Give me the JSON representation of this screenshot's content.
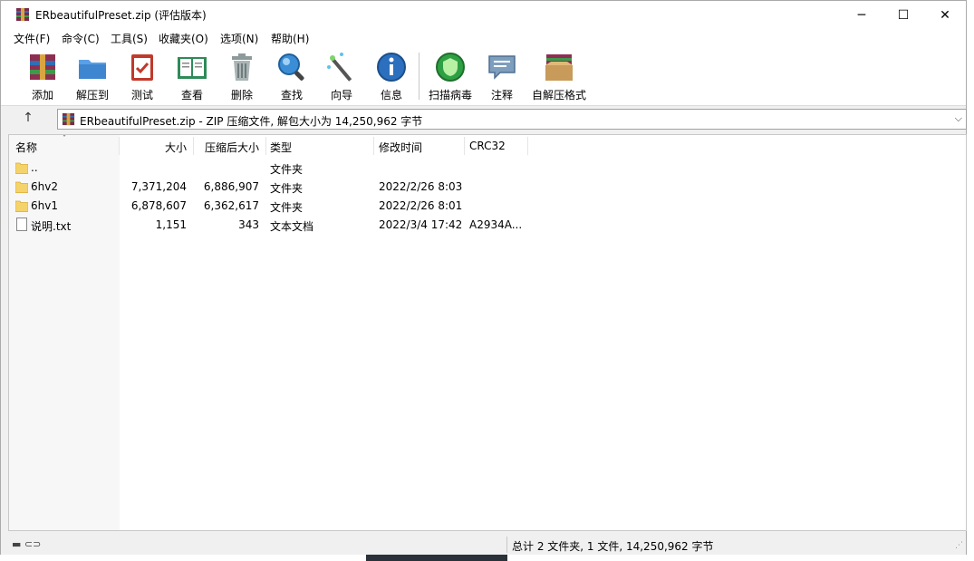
{
  "window": {
    "title": "ERbeautifulPreset.zip (评估版本)",
    "min_glyph": "─",
    "max_glyph": "☐",
    "close_glyph": "✕"
  },
  "menu": [
    {
      "label": "文件(F)"
    },
    {
      "label": "命令(C)"
    },
    {
      "label": "工具(S)"
    },
    {
      "label": "收藏夹(O)"
    },
    {
      "label": "选项(N)"
    },
    {
      "label": "帮助(H)"
    }
  ],
  "toolbar": [
    {
      "label": "添加",
      "icon": "add-archive-icon",
      "color": "#b03a5b"
    },
    {
      "label": "解压到",
      "icon": "extract-folder-icon",
      "color": "#4a90d9"
    },
    {
      "label": "测试",
      "icon": "test-clipboard-icon",
      "color": "#c0392b"
    },
    {
      "label": "查看",
      "icon": "view-book-icon",
      "color": "#2e8b57"
    },
    {
      "label": "删除",
      "icon": "trash-icon",
      "color": "#7f8c8d"
    },
    {
      "label": "查找",
      "icon": "magnifier-icon",
      "color": "#2980b9"
    },
    {
      "label": "向导",
      "icon": "wizard-wand-icon",
      "color": "#5a5a5a"
    },
    {
      "label": "信息",
      "icon": "info-icon",
      "color": "#2c6fbf"
    },
    {
      "label": "扫描病毒",
      "icon": "virus-scan-icon",
      "color": "#2ea043"
    },
    {
      "label": "注释",
      "icon": "comment-icon",
      "color": "#6d8fb0"
    },
    {
      "label": "自解压格式",
      "icon": "sfx-box-icon",
      "color": "#c89b5a"
    }
  ],
  "address": {
    "up_glyph": "↑",
    "text": "ERbeautifulPreset.zip - ZIP 压缩文件, 解包大小为 14,250,962 字节",
    "dropdown_glyph": "⌵"
  },
  "columns": {
    "name": "名称",
    "sort_glyph": "ˇ",
    "size": "大小",
    "packed": "压缩后大小",
    "type": "类型",
    "modified": "修改时间",
    "crc": "CRC32"
  },
  "rows": [
    {
      "name": "..",
      "size": "",
      "packed": "",
      "type": "文件夹",
      "modified": "",
      "crc": "",
      "kind": "folder"
    },
    {
      "name": "6hv2",
      "size": "7,371,204",
      "packed": "6,886,907",
      "type": "文件夹",
      "modified": "2022/2/26 8:03",
      "crc": "",
      "kind": "folder"
    },
    {
      "name": "6hv1",
      "size": "6,878,607",
      "packed": "6,362,617",
      "type": "文件夹",
      "modified": "2022/2/26 8:01",
      "crc": "",
      "kind": "folder"
    },
    {
      "name": "说明.txt",
      "size": "1,151",
      "packed": "343",
      "type": "文本文档",
      "modified": "2022/3/4 17:42",
      "crc": "A2934A...",
      "kind": "file"
    }
  ],
  "status": {
    "icons": "▬ ⊂⊃",
    "text": "总计 2 文件夹, 1 文件, 14,250,962 字节",
    "grip": "⋰"
  }
}
